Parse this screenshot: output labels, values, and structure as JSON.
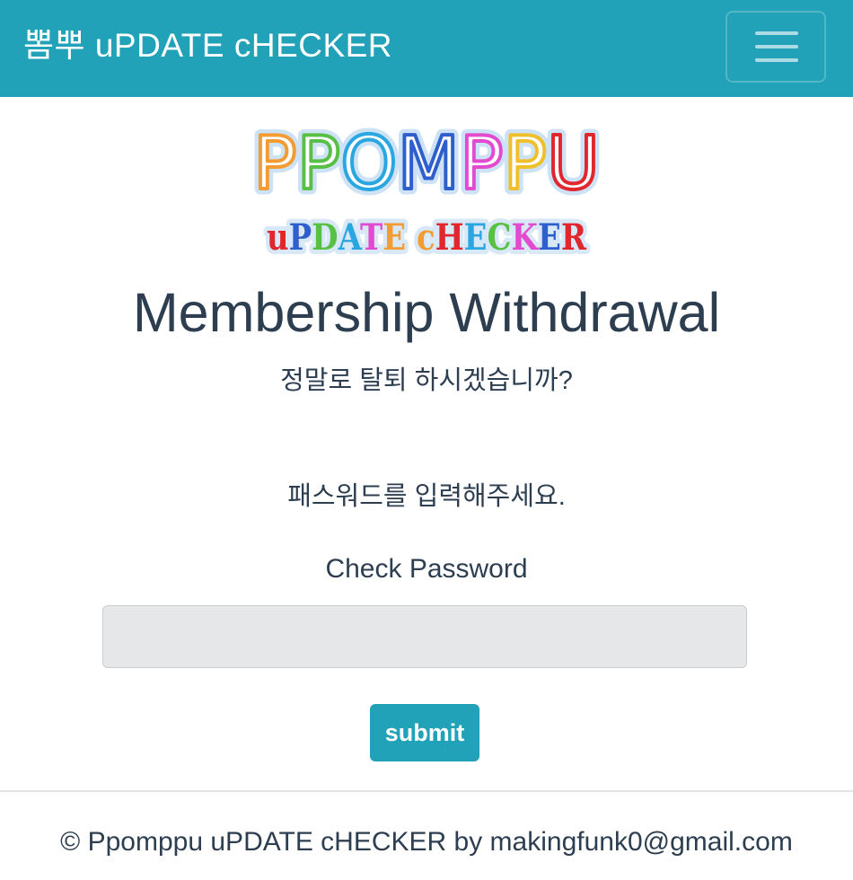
{
  "navbar": {
    "brand": "뽐뿌 uPDATE cHECKER",
    "menu_icon": "hamburger-menu-icon",
    "background_color": "#22a2b8"
  },
  "logo": {
    "line1": "PPOMPPU",
    "line2": "uPDATE cHECKER"
  },
  "main": {
    "title": "Membership Withdrawal",
    "subtitle": "정말로 탈퇴 하시겠습니까?",
    "prompt": "패스워드를 입력해주세요.",
    "password_label": "Check Password",
    "password_value": "",
    "submit_label": "submit"
  },
  "footer": {
    "text": "© Ppomppu uPDATE cHECKER by makingfunk0@gmail.com"
  },
  "colors": {
    "accent": "#22a2b8",
    "text": "#2c3e50",
    "input_bg": "#e5e7e9"
  }
}
